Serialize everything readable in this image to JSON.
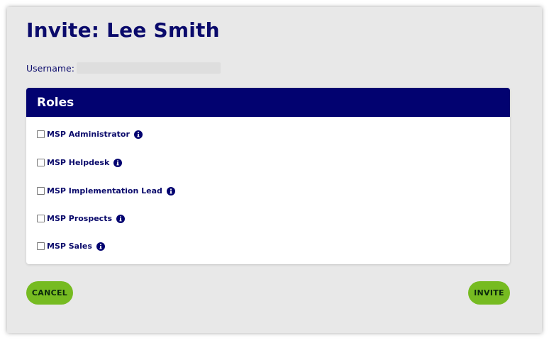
{
  "dialog": {
    "title": "Invite: Lee Smith",
    "username_label": "Username:"
  },
  "roles": {
    "title": "Roles",
    "items": [
      {
        "label": "MSP Administrator",
        "checked": false,
        "icon": "info-icon"
      },
      {
        "label": "MSP Helpdesk",
        "checked": false,
        "icon": "info-icon"
      },
      {
        "label": "MSP Implementation Lead",
        "checked": false,
        "icon": "info-icon"
      },
      {
        "label": "MSP Prospects",
        "checked": false,
        "icon": "info-icon"
      },
      {
        "label": "MSP Sales",
        "checked": false,
        "icon": "info-icon"
      }
    ]
  },
  "actions": {
    "cancel_label": "CANCEL",
    "invite_label": "INVITE"
  },
  "colors": {
    "navy": "#020270",
    "title_text": "#0a0a6b",
    "button_green": "#76bb21",
    "panel_background": "#e8e8e8"
  }
}
